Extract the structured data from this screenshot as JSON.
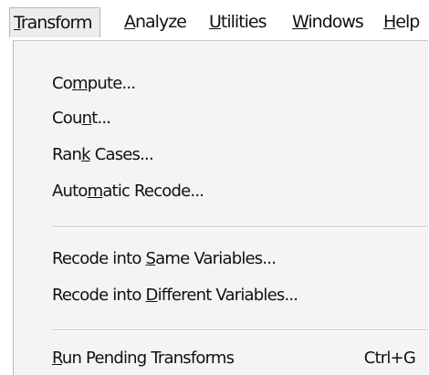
{
  "menubar": {
    "items": [
      {
        "pre": "",
        "mn": "T",
        "post": "ransform"
      },
      {
        "pre": "",
        "mn": "A",
        "post": "nalyze"
      },
      {
        "pre": "",
        "mn": "U",
        "post": "tilities"
      },
      {
        "pre": "",
        "mn": "W",
        "post": "indows"
      },
      {
        "pre": "",
        "mn": "H",
        "post": "elp"
      }
    ]
  },
  "dropdown": {
    "items": [
      {
        "pre": "Co",
        "mn": "m",
        "post": "pute..."
      },
      {
        "pre": "Cou",
        "mn": "n",
        "post": "t..."
      },
      {
        "pre": "Ran",
        "mn": "k",
        "post": " Cases..."
      },
      {
        "pre": "Auto",
        "mn": "m",
        "post": "atic Recode..."
      },
      {
        "pre": "Recode into ",
        "mn": "S",
        "post": "ame Variables..."
      },
      {
        "pre": "Recode into ",
        "mn": "D",
        "post": "ifferent Variables..."
      },
      {
        "pre": "",
        "mn": "R",
        "post": "un Pending Transforms",
        "shortcut": "Ctrl+G"
      }
    ]
  }
}
